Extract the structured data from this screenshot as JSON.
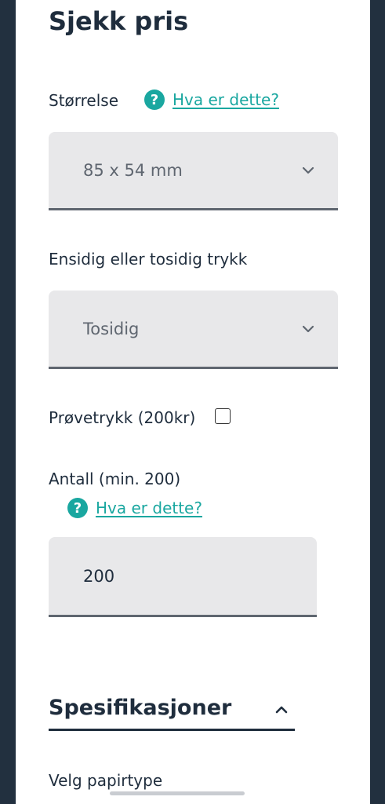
{
  "header": {
    "title": "Sjekk pris"
  },
  "size": {
    "label": "Størrelse",
    "help_link": "Hva er dette?",
    "selected": "85 x 54 mm"
  },
  "print_sides": {
    "label": "Ensidig eller tosidig trykk",
    "selected": "Tosidig"
  },
  "proof": {
    "label": "Prøvetrykk (200kr)",
    "checked": false
  },
  "quantity": {
    "label": "Antall (min. 200)",
    "help_link": "Hva er dette?",
    "value": "200"
  },
  "specs": {
    "title": "Spesifikasjoner",
    "paper_label": "Velg papirtype"
  },
  "icons": {
    "help": "question-circle-icon",
    "dropdown": "chevron-down-icon",
    "collapse": "chevron-up-icon"
  },
  "colors": {
    "accent": "#1aa7a0",
    "dark": "#1f2d3d",
    "frame": "#22303f",
    "field_bg": "#e8e8ea"
  }
}
